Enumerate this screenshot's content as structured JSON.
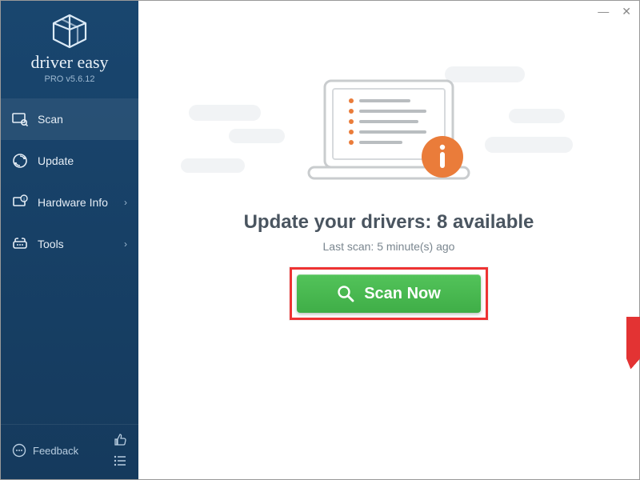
{
  "brand": {
    "name": "driver easy",
    "version": "PRO v5.6.12"
  },
  "sidebar": {
    "items": [
      {
        "label": "Scan",
        "icon": "scan-icon",
        "active": true,
        "arrow": false
      },
      {
        "label": "Update",
        "icon": "update-icon",
        "active": false,
        "arrow": false
      },
      {
        "label": "Hardware Info",
        "icon": "hardware-icon",
        "active": false,
        "arrow": true
      },
      {
        "label": "Tools",
        "icon": "tools-icon",
        "active": false,
        "arrow": true
      }
    ],
    "feedback_label": "Feedback"
  },
  "main": {
    "headline": "Update your drivers: 8 available",
    "subline": "Last scan: 5 minute(s) ago",
    "scan_label": "Scan Now",
    "available_count": 8
  },
  "colors": {
    "sidebar_bg": "#19466f",
    "scan_green": "#4ab851",
    "info_orange": "#ea7c3a",
    "highlight_red": "#e33333"
  }
}
